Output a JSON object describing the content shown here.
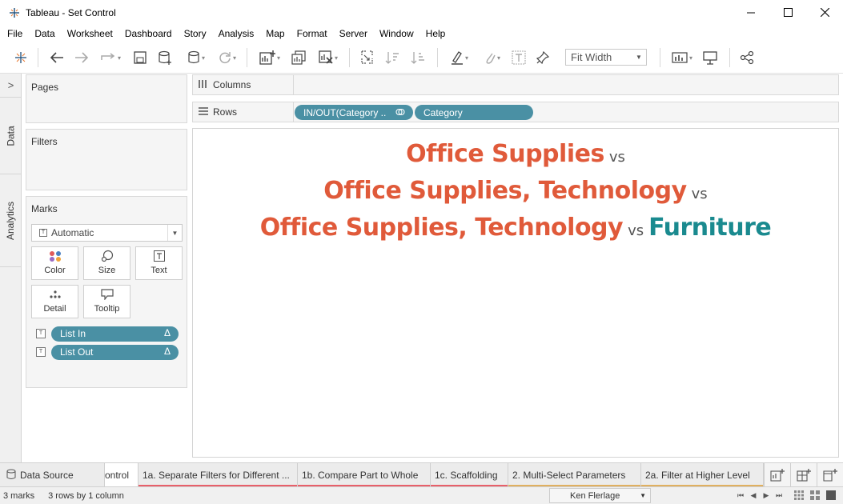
{
  "window": {
    "title": "Tableau - Set Control",
    "minimize_icon": "minimize-icon",
    "maximize_icon": "maximize-icon",
    "close_icon": "close-icon"
  },
  "menu": [
    "File",
    "Data",
    "Worksheet",
    "Dashboard",
    "Story",
    "Analysis",
    "Map",
    "Format",
    "Server",
    "Window",
    "Help"
  ],
  "toolbar": {
    "fit": "Fit Width"
  },
  "side_tabs": {
    "data": "Data",
    "analytics": "Analytics"
  },
  "cards": {
    "pages": "Pages",
    "filters": "Filters",
    "marks": "Marks",
    "mark_type": "Automatic",
    "mark_buttons": {
      "color": "Color",
      "size": "Size",
      "text": "Text",
      "detail": "Detail",
      "tooltip": "Tooltip"
    },
    "mark_pills": [
      {
        "label": "List In",
        "delta": "Δ"
      },
      {
        "label": "List Out",
        "delta": "Δ"
      }
    ]
  },
  "shelves": {
    "columns": "Columns",
    "rows": "Rows",
    "row_pills": [
      "IN/OUT(Category ..",
      "Category"
    ]
  },
  "viz": {
    "line1": {
      "in": "Office Supplies",
      "vs": "vs"
    },
    "line2": {
      "in": "Office Supplies, Technology",
      "vs": "vs"
    },
    "line3": {
      "in": "Office Supplies, Technology",
      "vs": "vs",
      "out": "Furniture"
    },
    "colors": {
      "in": "#e05a3a",
      "out": "#1a8a8f"
    }
  },
  "sheet_tabs": {
    "data_source": "Data Source",
    "tabs": [
      {
        "label": "ontrol",
        "underline": ""
      },
      {
        "label": "1a. Separate Filters for Different ...",
        "underline": "#e8606a"
      },
      {
        "label": "1b. Compare Part to Whole",
        "underline": "#e8606a"
      },
      {
        "label": "1c. Scaffolding",
        "underline": "#e8606a"
      },
      {
        "label": "2. Multi-Select Parameters",
        "underline": "#e0b060"
      },
      {
        "label": "2a. Filter at Higher Level",
        "underline": "#e0b060"
      }
    ]
  },
  "status": {
    "marks": "3 marks",
    "rows": "3 rows by 1 column",
    "user": "Ken Flerlage"
  }
}
